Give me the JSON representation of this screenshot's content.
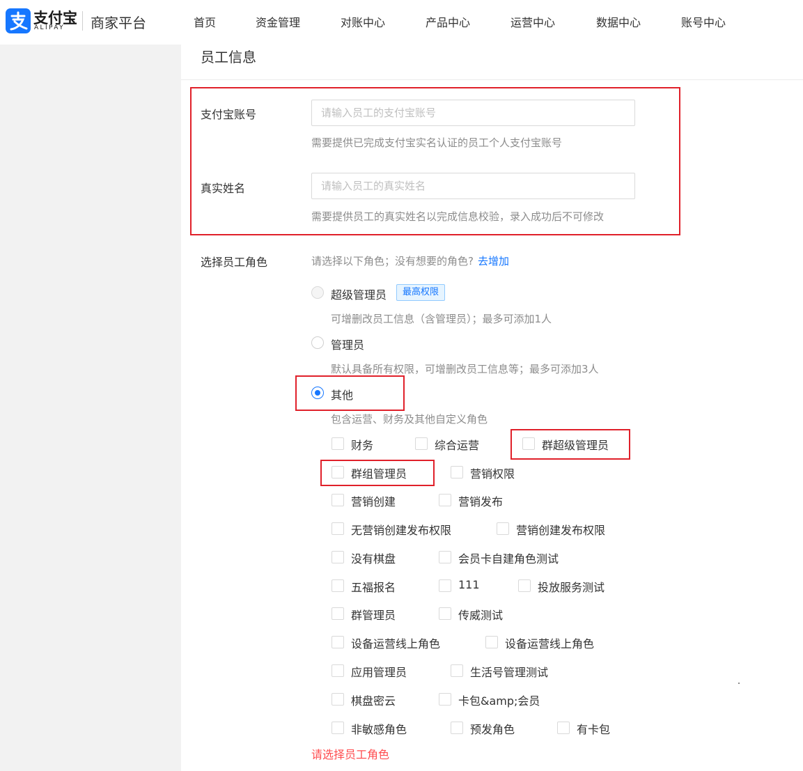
{
  "header": {
    "logo_cn": "支付宝",
    "logo_en": "ALIPAY",
    "platform": "商家平台",
    "nav": [
      "首页",
      "资金管理",
      "对账中心",
      "产品中心",
      "运营中心",
      "数据中心",
      "账号中心"
    ]
  },
  "section_title": "员工信息",
  "account": {
    "label": "支付宝账号",
    "placeholder": "请输入员工的支付宝账号",
    "value": "",
    "help": "需要提供已完成支付宝实名认证的员工个人支付宝账号"
  },
  "realname": {
    "label": "真实姓名",
    "placeholder": "请输入员工的真实姓名",
    "value": "",
    "help": "需要提供员工的真实姓名以完成信息校验，录入成功后不可修改"
  },
  "role": {
    "label": "选择员工角色",
    "hint": "请选择以下角色；没有想要的角色?",
    "add_link": "去增加",
    "options": [
      {
        "label": "超级管理员",
        "tag": "最高权限",
        "desc": "可增删改员工信息（含管理员）；最多可添加1人",
        "state": "disabled"
      },
      {
        "label": "管理员",
        "desc": "默认具备所有权限，可增删改员工信息等；最多可添加3人",
        "state": "unchecked"
      },
      {
        "label": "其他",
        "desc": "包含运营、财务及其他自定义角色",
        "state": "checked"
      }
    ],
    "custom_roles": [
      "财务",
      "综合运营",
      "群超级管理员",
      "群组管理员",
      "营销权限",
      "营销创建",
      "营销发布",
      "无营销创建发布权限",
      "营销创建发布权限",
      "没有棋盘",
      "会员卡自建角色测试",
      "五福报名",
      "111",
      "投放服务测试",
      "群管理员",
      "传威测试",
      "设备运营线上角色",
      "设备运营线上角色",
      "应用管理员",
      "生活号管理测试",
      "棋盘密云",
      "卡包&amp;会员",
      "非敏感角色",
      "预发角色",
      "有卡包"
    ],
    "error": "请选择员工角色"
  },
  "colors": {
    "primary": "#1677ff",
    "error": "#ff4d4f",
    "annotation": "#e0202a"
  }
}
